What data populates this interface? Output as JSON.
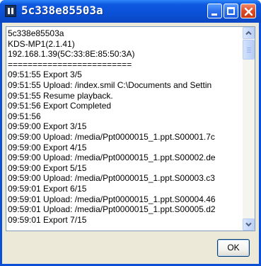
{
  "window": {
    "title": "5c338e85503a"
  },
  "log_lines": [
    "5c338e85503a",
    "KDS-MP1(2.1.41)",
    "192.168.1.39(5C:33:8E:85:50:3A)",
    "=========================",
    "09:51:55 Export 3/5",
    "09:51:55 Upload: /index.smil C:\\Documents and Settin",
    "09:51:55 Resume playback.",
    "09:51:56 Export Completed",
    "09:51:56",
    "09:59:00 Export 3/15",
    "09:59:00 Upload: /media/Ppt0000015_1.ppt.S00001.7c",
    "09:59:00 Export 4/15",
    "09:59:00 Upload: /media/Ppt0000015_1.ppt.S00002.de",
    "09:59:00 Export 5/15",
    "09:59:00 Upload: /media/Ppt0000015_1.ppt.S00003.c3",
    "09:59:01 Export 6/15",
    "09:59:01 Upload: /media/Ppt0000015_1.ppt.S00004.46",
    "09:59:01 Upload: /media/Ppt0000015_1.ppt.S00005.d2",
    "09:59:01 Export 7/15"
  ],
  "buttons": {
    "ok_label": "OK"
  },
  "icons": {
    "app": "app-icon",
    "minimize": "minimize-icon",
    "maximize": "maximize-icon",
    "close": "close-icon",
    "scroll_up": "arrow-up-icon",
    "scroll_down": "arrow-down-icon"
  },
  "colors": {
    "titlebar": "#0a50d6",
    "close_button": "#df4a25",
    "dialog_face": "#ece9d8"
  }
}
